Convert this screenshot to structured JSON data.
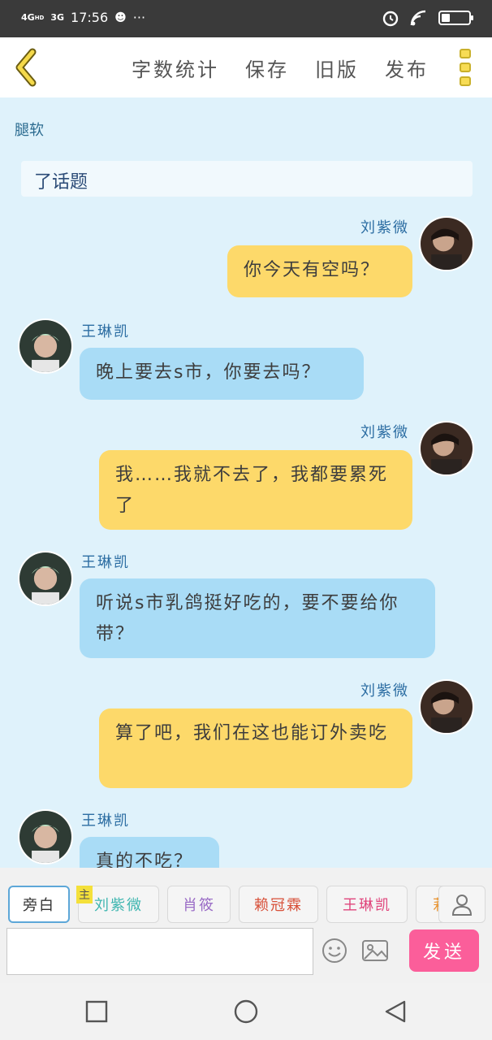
{
  "status_bar": {
    "network1": "4G",
    "network1_sup": "HD",
    "network2": "3G",
    "time": "17:56",
    "more": "···",
    "battery_level": "19"
  },
  "app_bar": {
    "actions": [
      "字数统计",
      "保存",
      "旧版",
      "发布"
    ]
  },
  "chat": {
    "title": "腿软",
    "note_text": "了话题",
    "messages": [
      {
        "sender": "刘紫微",
        "side": "right",
        "color": "yellow",
        "text": "你今天有空吗？"
      },
      {
        "sender": "王琳凯",
        "side": "left",
        "color": "blue",
        "text": "晚上要去s市，你要去吗？"
      },
      {
        "sender": "刘紫微",
        "side": "right",
        "color": "yellow",
        "text": "我……我就不去了，我都要累死了"
      },
      {
        "sender": "王琳凯",
        "side": "left",
        "color": "blue",
        "text": "听说s市乳鸽挺好吃的，要不要给你带？"
      },
      {
        "sender": "刘紫微",
        "side": "right",
        "color": "yellow",
        "text": "算了吧，我们在这也能订外卖吃"
      },
      {
        "sender": "王琳凯",
        "side": "left",
        "color": "blue",
        "text": "真的不吃？"
      }
    ]
  },
  "roles": {
    "main_tag": "主",
    "items": [
      {
        "label": "旁白",
        "color": "#333333"
      },
      {
        "label": "刘紫微",
        "color": "#3fb6b0"
      },
      {
        "label": "肖筱",
        "color": "#9a6cc6"
      },
      {
        "label": "赖冠霖",
        "color": "#d8513a"
      },
      {
        "label": "王琳凯",
        "color": "#e0457c"
      },
      {
        "label": "莉",
        "color": "#e8932f"
      }
    ]
  },
  "input": {
    "placeholder": "",
    "send_label": "发送"
  },
  "colors": {
    "yellow_bubble": "#fdd96a",
    "blue_bubble": "#a9dcf6",
    "send_button": "#fb5e9a",
    "chat_bg": "#dff2fb"
  }
}
